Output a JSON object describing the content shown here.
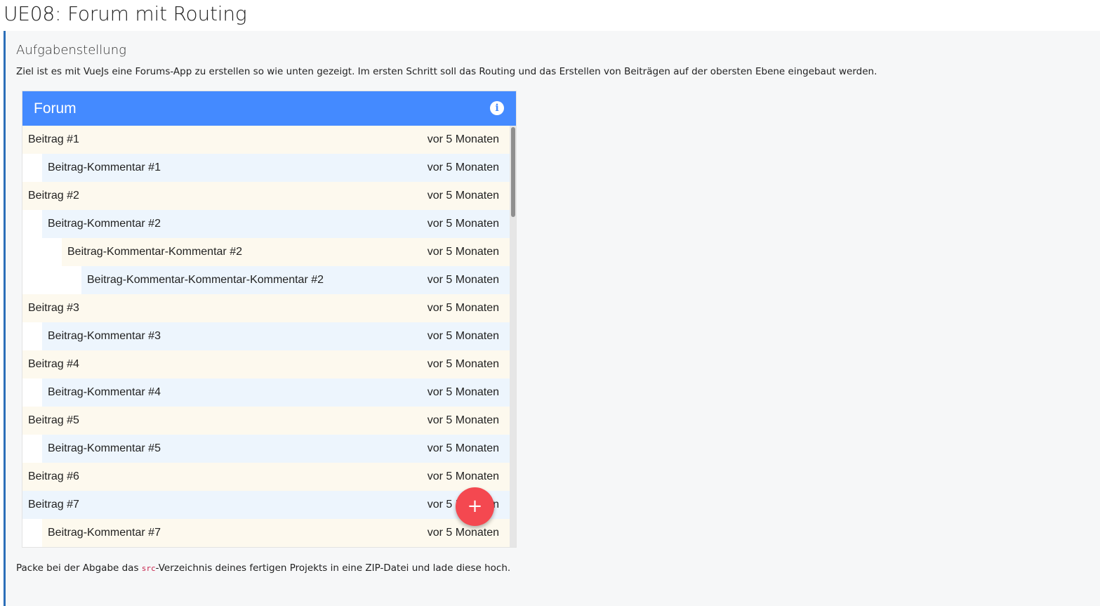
{
  "page": {
    "title": "UE08: Forum mit Routing"
  },
  "task": {
    "heading": "Aufgabenstellung",
    "intro": "Ziel ist es mit VueJs eine Forums-App zu erstellen so wie unten gezeigt. Im ersten Schritt soll das Routing und das Erstellen von Beiträgen auf der obersten Ebene eingebaut werden.",
    "outro_before": "Packe bei der Abgabe das ",
    "outro_code": "src",
    "outro_after": "-Verzeichnis deines fertigen Projekts in eine ZIP-Datei und lade diese hoch."
  },
  "app": {
    "title": "Forum",
    "info_icon": "info-icon",
    "info_glyph": "i",
    "fab_icon": "plus-icon",
    "fab_glyph": "+",
    "colors": {
      "header": "#448aff",
      "row_cream": "#fdf9ee",
      "row_blue": "#edf5fd",
      "fab": "#f44850"
    },
    "posts": [
      {
        "title": "Beitrag #1",
        "time": "vor 5 Monaten",
        "depth": 0
      },
      {
        "title": "Beitrag-Kommentar #1",
        "time": "vor 5 Monaten",
        "depth": 1
      },
      {
        "title": "Beitrag #2",
        "time": "vor 5 Monaten",
        "depth": 0
      },
      {
        "title": "Beitrag-Kommentar #2",
        "time": "vor 5 Monaten",
        "depth": 1
      },
      {
        "title": "Beitrag-Kommentar-Kommentar #2",
        "time": "vor 5 Monaten",
        "depth": 2
      },
      {
        "title": "Beitrag-Kommentar-Kommentar-Kommentar #2",
        "time": "vor 5 Monaten",
        "depth": 3
      },
      {
        "title": "Beitrag #3",
        "time": "vor 5 Monaten",
        "depth": 0
      },
      {
        "title": "Beitrag-Kommentar #3",
        "time": "vor 5 Monaten",
        "depth": 1
      },
      {
        "title": "Beitrag #4",
        "time": "vor 5 Monaten",
        "depth": 0
      },
      {
        "title": "Beitrag-Kommentar #4",
        "time": "vor 5 Monaten",
        "depth": 1
      },
      {
        "title": "Beitrag #5",
        "time": "vor 5 Monaten",
        "depth": 0
      },
      {
        "title": "Beitrag-Kommentar #5",
        "time": "vor 5 Monaten",
        "depth": 1
      },
      {
        "title": "Beitrag #6",
        "time": "vor 5 Monaten",
        "depth": 0
      },
      {
        "title": "Beitrag #7",
        "time": "vor 5 Monaten",
        "depth": 0
      },
      {
        "title": "Beitrag-Kommentar #7",
        "time": "vor 5 Monaten",
        "depth": 1
      }
    ]
  }
}
